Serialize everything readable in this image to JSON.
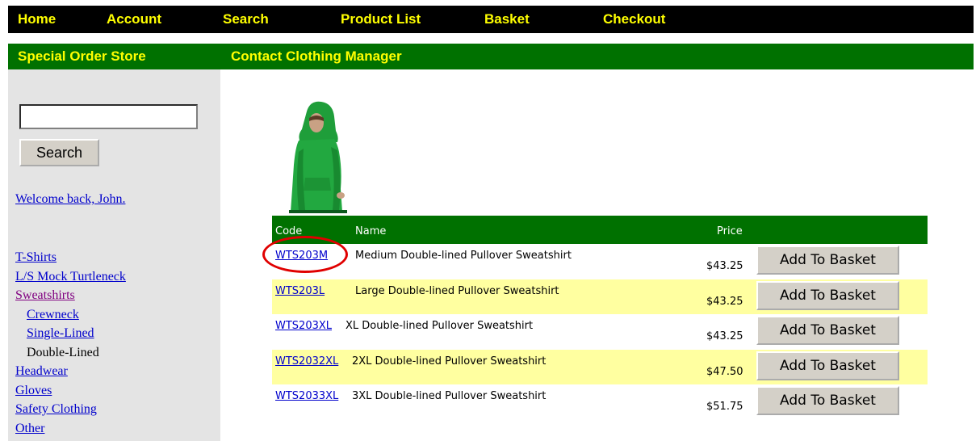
{
  "topnav": {
    "items": [
      "Home",
      "Account",
      "Search",
      "Product List",
      "Basket",
      "Checkout"
    ]
  },
  "subnav": {
    "items": [
      "Special Order Store",
      "Contact Clothing Manager"
    ]
  },
  "sidebar": {
    "search_value": "",
    "search_button": "Search",
    "welcome": "Welcome back, John.",
    "categories": [
      {
        "label": "T-Shirts"
      },
      {
        "label": "L/S Mock Turtleneck"
      },
      {
        "label": "Sweatshirts"
      },
      {
        "label": "Crewneck"
      },
      {
        "label": "Single-Lined"
      },
      {
        "label": "Double-Lined"
      },
      {
        "label": "Headwear"
      },
      {
        "label": "Gloves"
      },
      {
        "label": "Safety Clothing"
      },
      {
        "label": "Other"
      }
    ]
  },
  "products": {
    "headers": {
      "code": "Code",
      "name": "Name",
      "price": "Price"
    },
    "rows": [
      {
        "code": "WTS203M",
        "name": "Medium Double-lined Pullover Sweatshirt",
        "price": "$43.25",
        "button": "Add To Basket"
      },
      {
        "code": "WTS203L",
        "name": "Large Double-lined Pullover Sweatshirt",
        "price": "$43.25",
        "button": "Add To Basket"
      },
      {
        "code": "WTS203XL",
        "name": "XL Double-lined Pullover Sweatshirt",
        "price": "$43.25",
        "button": "Add To Basket"
      },
      {
        "code": "WTS2032XL",
        "name": "2XL Double-lined Pullover Sweatshirt",
        "price": "$47.50",
        "button": "Add To Basket"
      },
      {
        "code": "WTS2033XL",
        "name": "3XL Double-lined Pullover Sweatshirt",
        "price": "$51.75",
        "button": "Add To Basket"
      }
    ]
  },
  "colors": {
    "nav_black": "#000000",
    "nav_green": "#007100",
    "nav_text": "#ffff00",
    "row_alt": "#ffffa0",
    "highlight": "#e00000"
  }
}
